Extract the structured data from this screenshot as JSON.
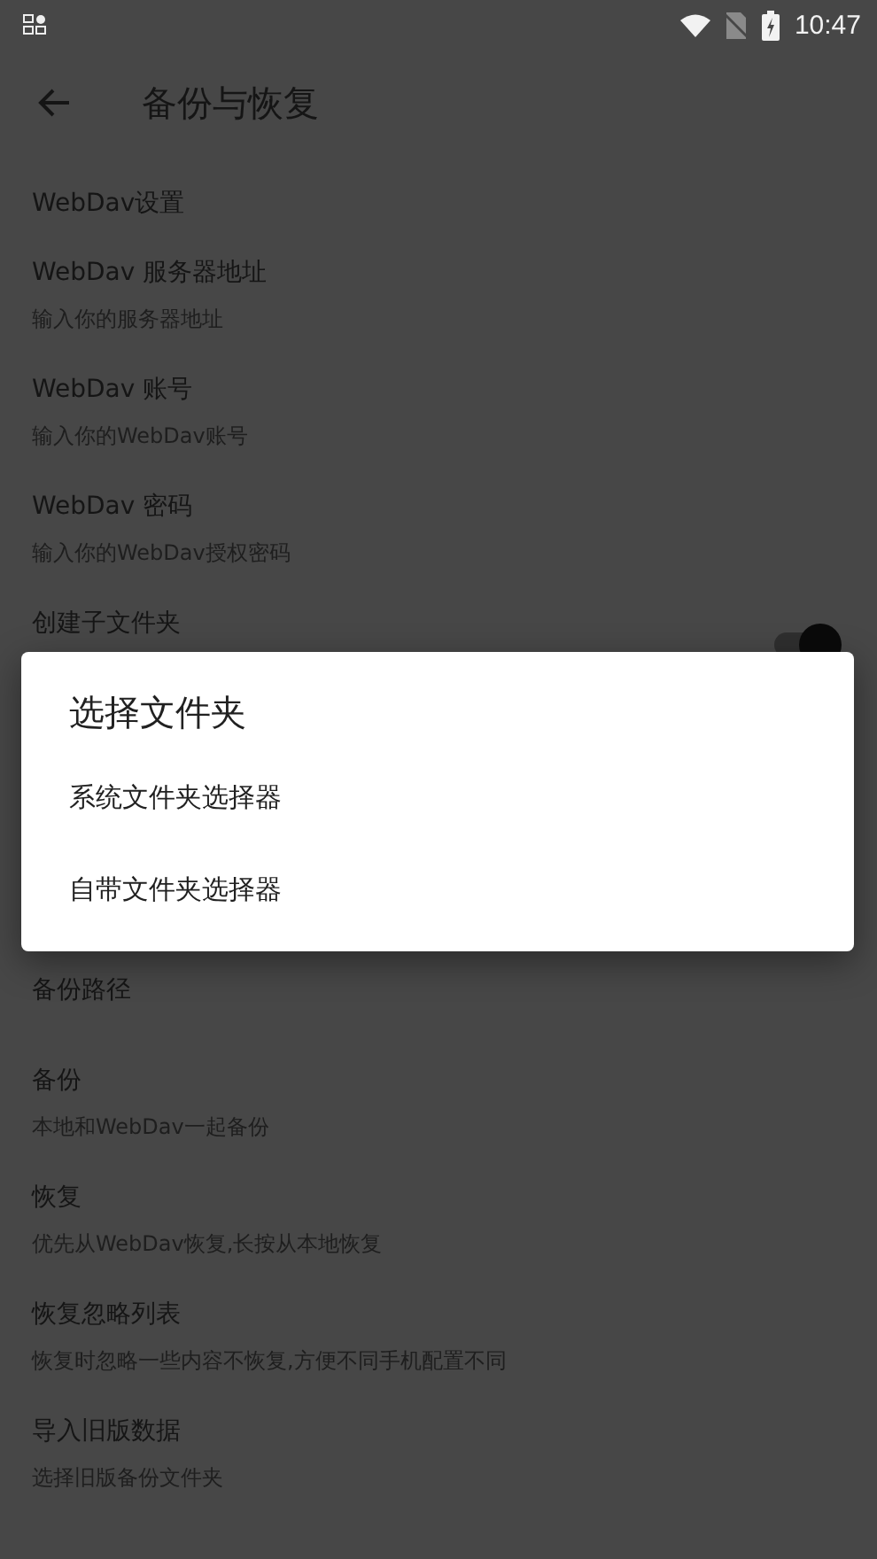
{
  "status_bar": {
    "time": "10:47"
  },
  "toolbar": {
    "title": "备份与恢复"
  },
  "preferences_top": [
    {
      "kind": "header",
      "title": "WebDav设置"
    },
    {
      "kind": "text",
      "title": "WebDav 服务器地址",
      "summary": "输入你的服务器地址"
    },
    {
      "kind": "text",
      "title": "WebDav 账号",
      "summary": "输入你的WebDav账号"
    },
    {
      "kind": "text",
      "title": "WebDav 密码",
      "summary": "输入你的WebDav授权密码"
    },
    {
      "kind": "switch",
      "title": "创建子文件夹",
      "checked": true
    }
  ],
  "preferences_bottom": [
    {
      "kind": "plain",
      "title": "备份路径"
    },
    {
      "kind": "text",
      "title": "备份",
      "summary": "本地和WebDav一起备份"
    },
    {
      "kind": "text",
      "title": "恢复",
      "summary": "优先从WebDav恢复,长按从本地恢复"
    },
    {
      "kind": "text",
      "title": "恢复忽略列表",
      "summary": "恢复时忽略一些内容不恢复,方便不同手机配置不同"
    },
    {
      "kind": "text",
      "title": "导入旧版数据",
      "summary": "选择旧版备份文件夹"
    }
  ],
  "dialog": {
    "title": "选择文件夹",
    "options": [
      "系统文件夹选择器",
      "自带文件夹选择器"
    ]
  }
}
